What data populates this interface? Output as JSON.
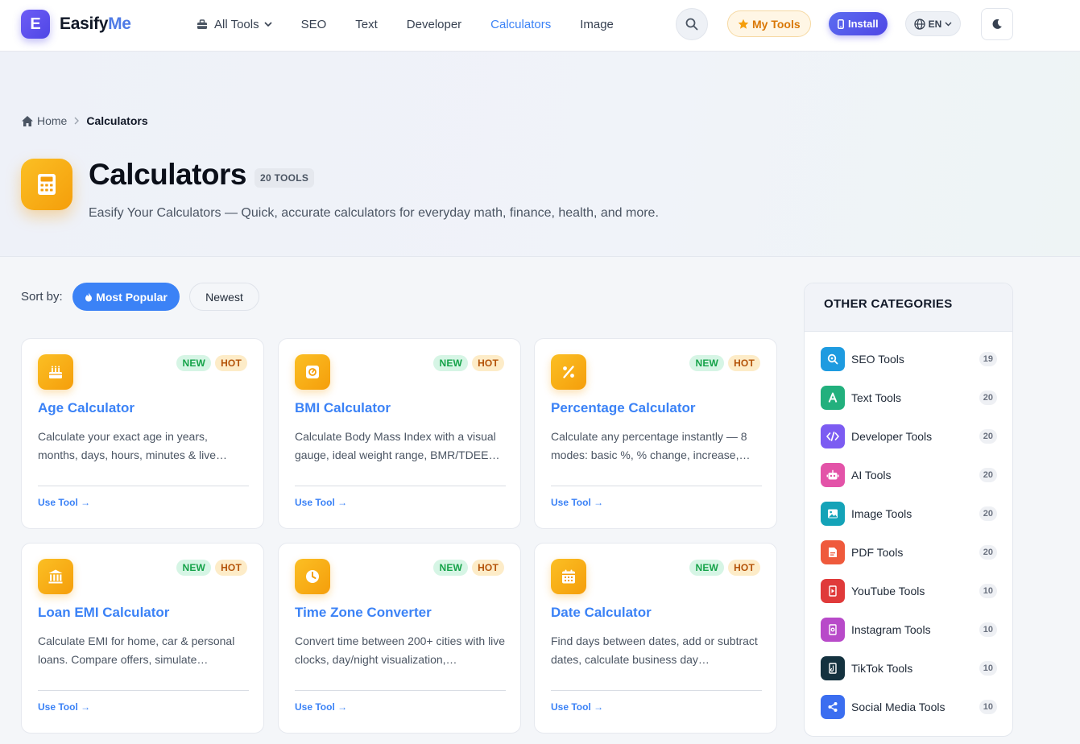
{
  "brand": {
    "mark": "E",
    "name_main": "Easify",
    "name_accent": "Me"
  },
  "nav": {
    "all_tools": "All Tools",
    "items": [
      "SEO",
      "Text",
      "Developer",
      "Calculators",
      "Image"
    ],
    "active": "Calculators"
  },
  "header": {
    "my_tools": "My Tools",
    "install": "Install",
    "lang": "EN"
  },
  "breadcrumb": {
    "home": "Home",
    "current": "Calculators"
  },
  "hero": {
    "title": "Calculators",
    "count": "20 TOOLS",
    "description": "Easify Your Calculators — Quick, accurate calculators for everyday math, finance, health, and more."
  },
  "sort": {
    "label": "Sort by:",
    "popular": "Most Popular",
    "newest": "Newest"
  },
  "cards": [
    {
      "title": "Age Calculator",
      "description": "Calculate your exact age in years, months, days, hours, minutes & live…",
      "icon": "cake-icon",
      "badges": [
        "NEW",
        "HOT"
      ],
      "cta": "Use Tool →"
    },
    {
      "title": "BMI Calculator",
      "description": "Calculate Body Mass Index with a visual gauge, ideal weight range, BMR/TDEE…",
      "icon": "scale-icon",
      "badges": [
        "NEW",
        "HOT"
      ],
      "cta": "Use Tool →"
    },
    {
      "title": "Percentage Calculator",
      "description": "Calculate any percentage instantly — 8 modes: basic %, % change, increase,…",
      "icon": "percent-icon",
      "badges": [
        "NEW",
        "HOT"
      ],
      "cta": "Use Tool →"
    },
    {
      "title": "Loan EMI Calculator",
      "description": "Calculate EMI for home, car & personal loans. Compare offers, simulate…",
      "icon": "bank-icon",
      "badges": [
        "NEW",
        "HOT"
      ],
      "cta": "Use Tool →"
    },
    {
      "title": "Time Zone Converter",
      "description": "Convert time between 200+ cities with live clocks, day/night visualization,…",
      "icon": "clock-icon",
      "badges": [
        "NEW",
        "HOT"
      ],
      "cta": "Use Tool →"
    },
    {
      "title": "Date Calculator",
      "description": "Find days between dates, add or subtract dates, calculate business day…",
      "icon": "calendar-icon",
      "badges": [
        "NEW",
        "HOT"
      ],
      "cta": "Use Tool →"
    }
  ],
  "sidebar": {
    "heading": "OTHER CATEGORIES",
    "items": [
      {
        "name": "SEO Tools",
        "count": "19",
        "color": "#1e9be0",
        "icon": "seo-search-icon"
      },
      {
        "name": "Text Tools",
        "count": "20",
        "color": "#22b07d",
        "icon": "letter-a-icon"
      },
      {
        "name": "Developer Tools",
        "count": "20",
        "color": "#7c5cf2",
        "icon": "code-icon"
      },
      {
        "name": "AI Tools",
        "count": "20",
        "color": "#e353a8",
        "icon": "robot-icon"
      },
      {
        "name": "Image Tools",
        "count": "20",
        "color": "#14a3b8",
        "icon": "image-icon"
      },
      {
        "name": "PDF Tools",
        "count": "20",
        "color": "#ef5a3c",
        "icon": "pdf-icon"
      },
      {
        "name": "YouTube Tools",
        "count": "10",
        "color": "#e03a3a",
        "icon": "youtube-icon"
      },
      {
        "name": "Instagram Tools",
        "count": "10",
        "color": "#b84ac9",
        "icon": "instagram-icon"
      },
      {
        "name": "TikTok Tools",
        "count": "10",
        "color": "#14323f",
        "icon": "tiktok-icon"
      },
      {
        "name": "Social Media Tools",
        "count": "10",
        "color": "#3b6ef0",
        "icon": "share-icon"
      }
    ]
  },
  "colors": {
    "accent": "#3b82f6",
    "brand": "#4f46e5",
    "calculator": "#f59e0b"
  }
}
